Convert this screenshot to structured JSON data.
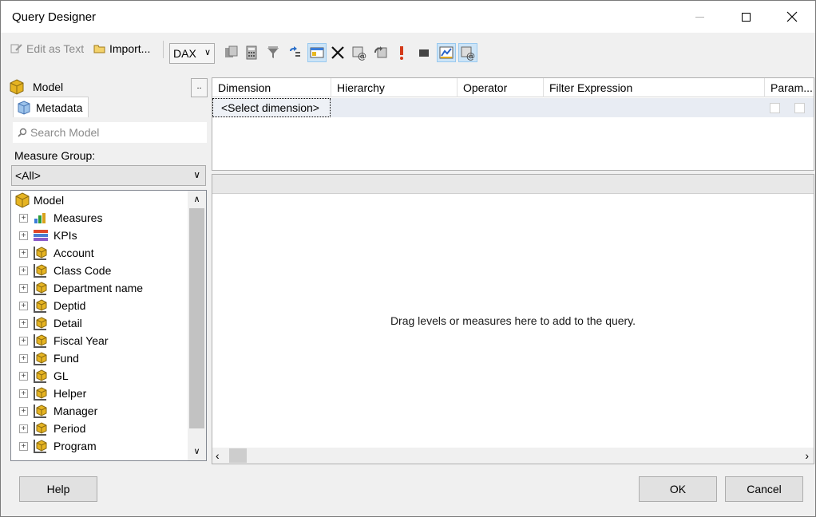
{
  "window": {
    "title": "Query Designer"
  },
  "toolbar": {
    "edit_as_text": "Edit as Text",
    "import": "Import...",
    "language": "DAX"
  },
  "left_panel": {
    "cube_label": "Model",
    "browse_label": "..",
    "metadata_tab": "Metadata",
    "search_placeholder": "Search Model",
    "measure_group_label": "Measure Group:",
    "measure_group_value": "<All>",
    "tree": {
      "root": "Model",
      "items": [
        {
          "label": "Measures",
          "icon": "measures-icon"
        },
        {
          "label": "KPIs",
          "icon": "kpi-icon"
        },
        {
          "label": "Account",
          "icon": "dimension-icon"
        },
        {
          "label": "Class Code",
          "icon": "dimension-icon"
        },
        {
          "label": "Department name",
          "icon": "dimension-icon"
        },
        {
          "label": "Deptid",
          "icon": "dimension-icon"
        },
        {
          "label": "Detail",
          "icon": "dimension-icon"
        },
        {
          "label": "Fiscal Year",
          "icon": "dimension-icon"
        },
        {
          "label": "Fund",
          "icon": "dimension-icon"
        },
        {
          "label": "GL",
          "icon": "dimension-icon"
        },
        {
          "label": "Helper",
          "icon": "dimension-icon"
        },
        {
          "label": "Manager",
          "icon": "dimension-icon"
        },
        {
          "label": "Period",
          "icon": "dimension-icon"
        },
        {
          "label": "Program",
          "icon": "dimension-icon"
        }
      ]
    }
  },
  "filter_grid": {
    "columns": [
      "Dimension",
      "Hierarchy",
      "Operator",
      "Filter Expression",
      "Param..."
    ],
    "row": {
      "dimension": "<Select dimension>"
    }
  },
  "results": {
    "drop_hint": "Drag levels or measures here to add to the query."
  },
  "buttons": {
    "help": "Help",
    "ok": "OK",
    "cancel": "Cancel"
  },
  "colors": {
    "accent_toggle": "#cce4f7",
    "cube_gold": "#e6b422"
  }
}
